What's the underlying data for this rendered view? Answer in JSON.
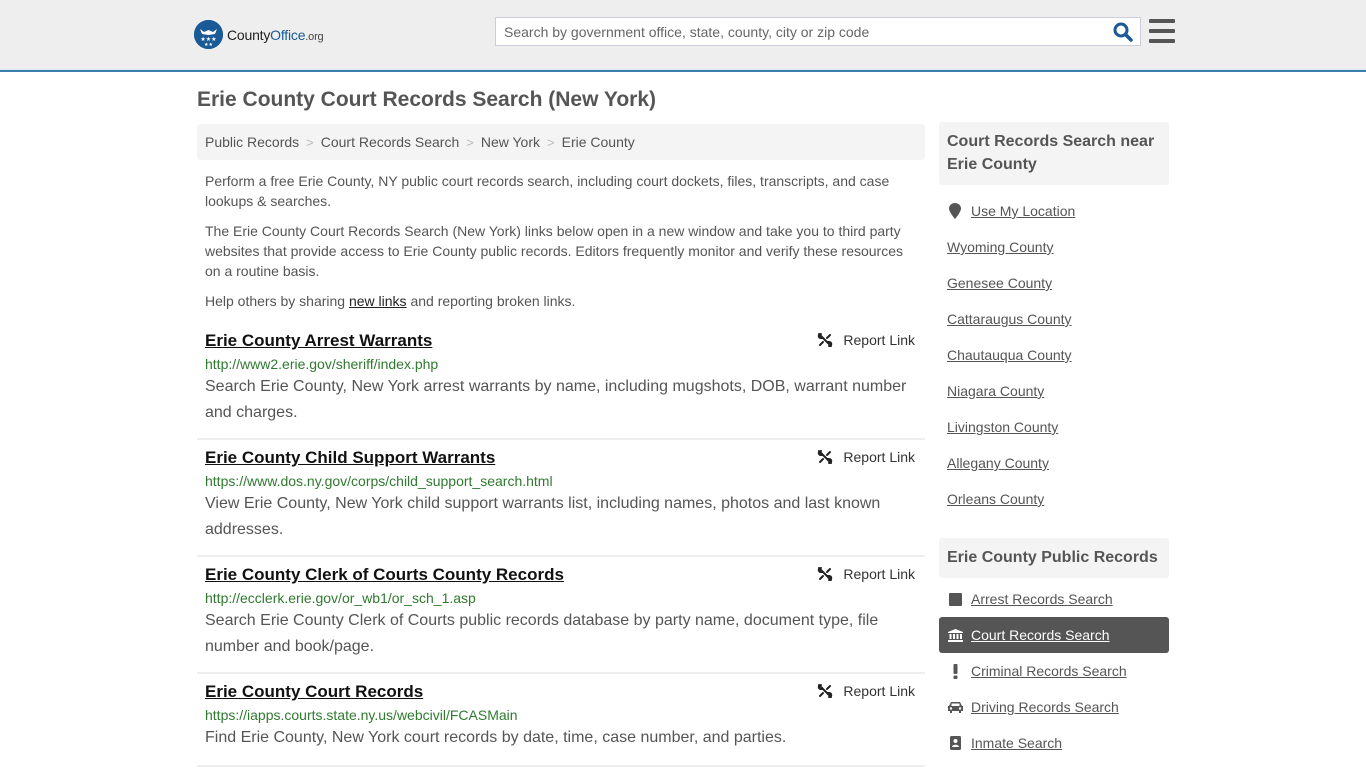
{
  "header": {
    "logo": {
      "name": "County",
      "brand": "Office",
      "tld": ".org"
    },
    "search": {
      "placeholder": "Search by government office, state, county, city or zip code",
      "value": ""
    },
    "accent_color": "#3b7fad"
  },
  "page": {
    "title": "Erie County Court Records Search (New York)"
  },
  "breadcrumb": [
    {
      "label": "Public Records"
    },
    {
      "label": "Court Records Search"
    },
    {
      "label": "New York"
    },
    {
      "label": "Erie County"
    }
  ],
  "intro": {
    "p1": "Perform a free Erie County, NY public court records search, including court dockets, files, transcripts, and case lookups & searches.",
    "p2": "The Erie County Court Records Search (New York) links below open in a new window and take you to third party websites that provide access to Erie County public records. Editors frequently monitor and verify these resources on a routine basis.",
    "p3_before": "Help others by sharing ",
    "p3_link": "new links",
    "p3_after": " and reporting broken links."
  },
  "results": [
    {
      "title": "Erie County Arrest Warrants",
      "url": "http://www2.erie.gov/sheriff/index.php",
      "description": "Search Erie County, New York arrest warrants by name, including mugshots, DOB, warrant number and charges.",
      "report_label": "Report Link"
    },
    {
      "title": "Erie County Child Support Warrants",
      "url": "https://www.dos.ny.gov/corps/child_support_search.html",
      "description": "View Erie County, New York child support warrants list, including names, photos and last known addresses.",
      "report_label": "Report Link"
    },
    {
      "title": "Erie County Clerk of Courts County Records",
      "url": "http://ecclerk.erie.gov/or_wb1/or_sch_1.asp",
      "description": "Search Erie County Clerk of Courts public records database by party name, document type, file number and book/page.",
      "report_label": "Report Link"
    },
    {
      "title": "Erie County Court Records",
      "url": "https://iapps.courts.state.ny.us/webcivil/FCASMain",
      "description": "Find Erie County, New York court records by date, time, case number, and parties.",
      "report_label": "Report Link"
    }
  ],
  "sidebar": {
    "near_heading": "Court Records Search near Erie County",
    "use_location": {
      "label": "Use My Location",
      "icon": "map-marker-icon"
    },
    "nearby": [
      {
        "label": "Wyoming County"
      },
      {
        "label": "Genesee County"
      },
      {
        "label": "Cattaraugus County"
      },
      {
        "label": "Chautauqua County"
      },
      {
        "label": "Niagara County"
      },
      {
        "label": "Livingston County"
      },
      {
        "label": "Allegany County"
      },
      {
        "label": "Orleans County"
      }
    ],
    "public_records_heading": "Erie County Public Records",
    "public_records": [
      {
        "label": "Arrest Records Search",
        "icon": "square-icon",
        "active": false
      },
      {
        "label": "Court Records Search",
        "icon": "courthouse-icon",
        "active": true
      },
      {
        "label": "Criminal Records Search",
        "icon": "exclamation-icon",
        "active": false
      },
      {
        "label": "Driving Records Search",
        "icon": "car-icon",
        "active": false
      },
      {
        "label": "Inmate Search",
        "icon": "id-badge-icon",
        "active": false
      }
    ]
  }
}
